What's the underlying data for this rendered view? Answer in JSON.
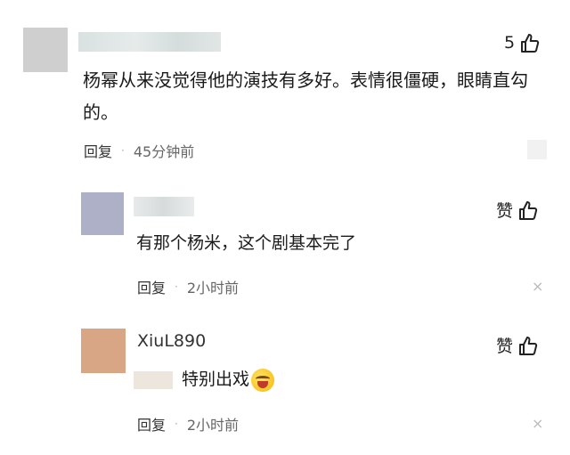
{
  "comment_main": {
    "like_count": "5",
    "text_line1": "杨幂从来没觉得他的演技有多好。表情很僵硬，眼睛直勾",
    "text_line2": "的。",
    "reply_label": "回复",
    "separator": "·",
    "time": "45分钟前"
  },
  "reply_1": {
    "like_label": "赞",
    "text": "有那个杨米，这个剧基本完了",
    "reply_label": "回复",
    "separator": "·",
    "time": "2小时前",
    "close": "×"
  },
  "reply_2": {
    "username": "XiuL890",
    "like_label": "赞",
    "text": "特别出戏",
    "reply_label": "回复",
    "separator": "·",
    "time": "2小时前",
    "close": "×"
  },
  "colors": {
    "avatar_main": "#cfcfcf",
    "avatar_reply1": "#aeb0c8",
    "avatar_reply2": "#d8a585",
    "name_blur": "#dde3e3"
  },
  "icons": [
    "thumbs-up-icon",
    "close-icon",
    "laughing-crying-emoji-icon"
  ]
}
